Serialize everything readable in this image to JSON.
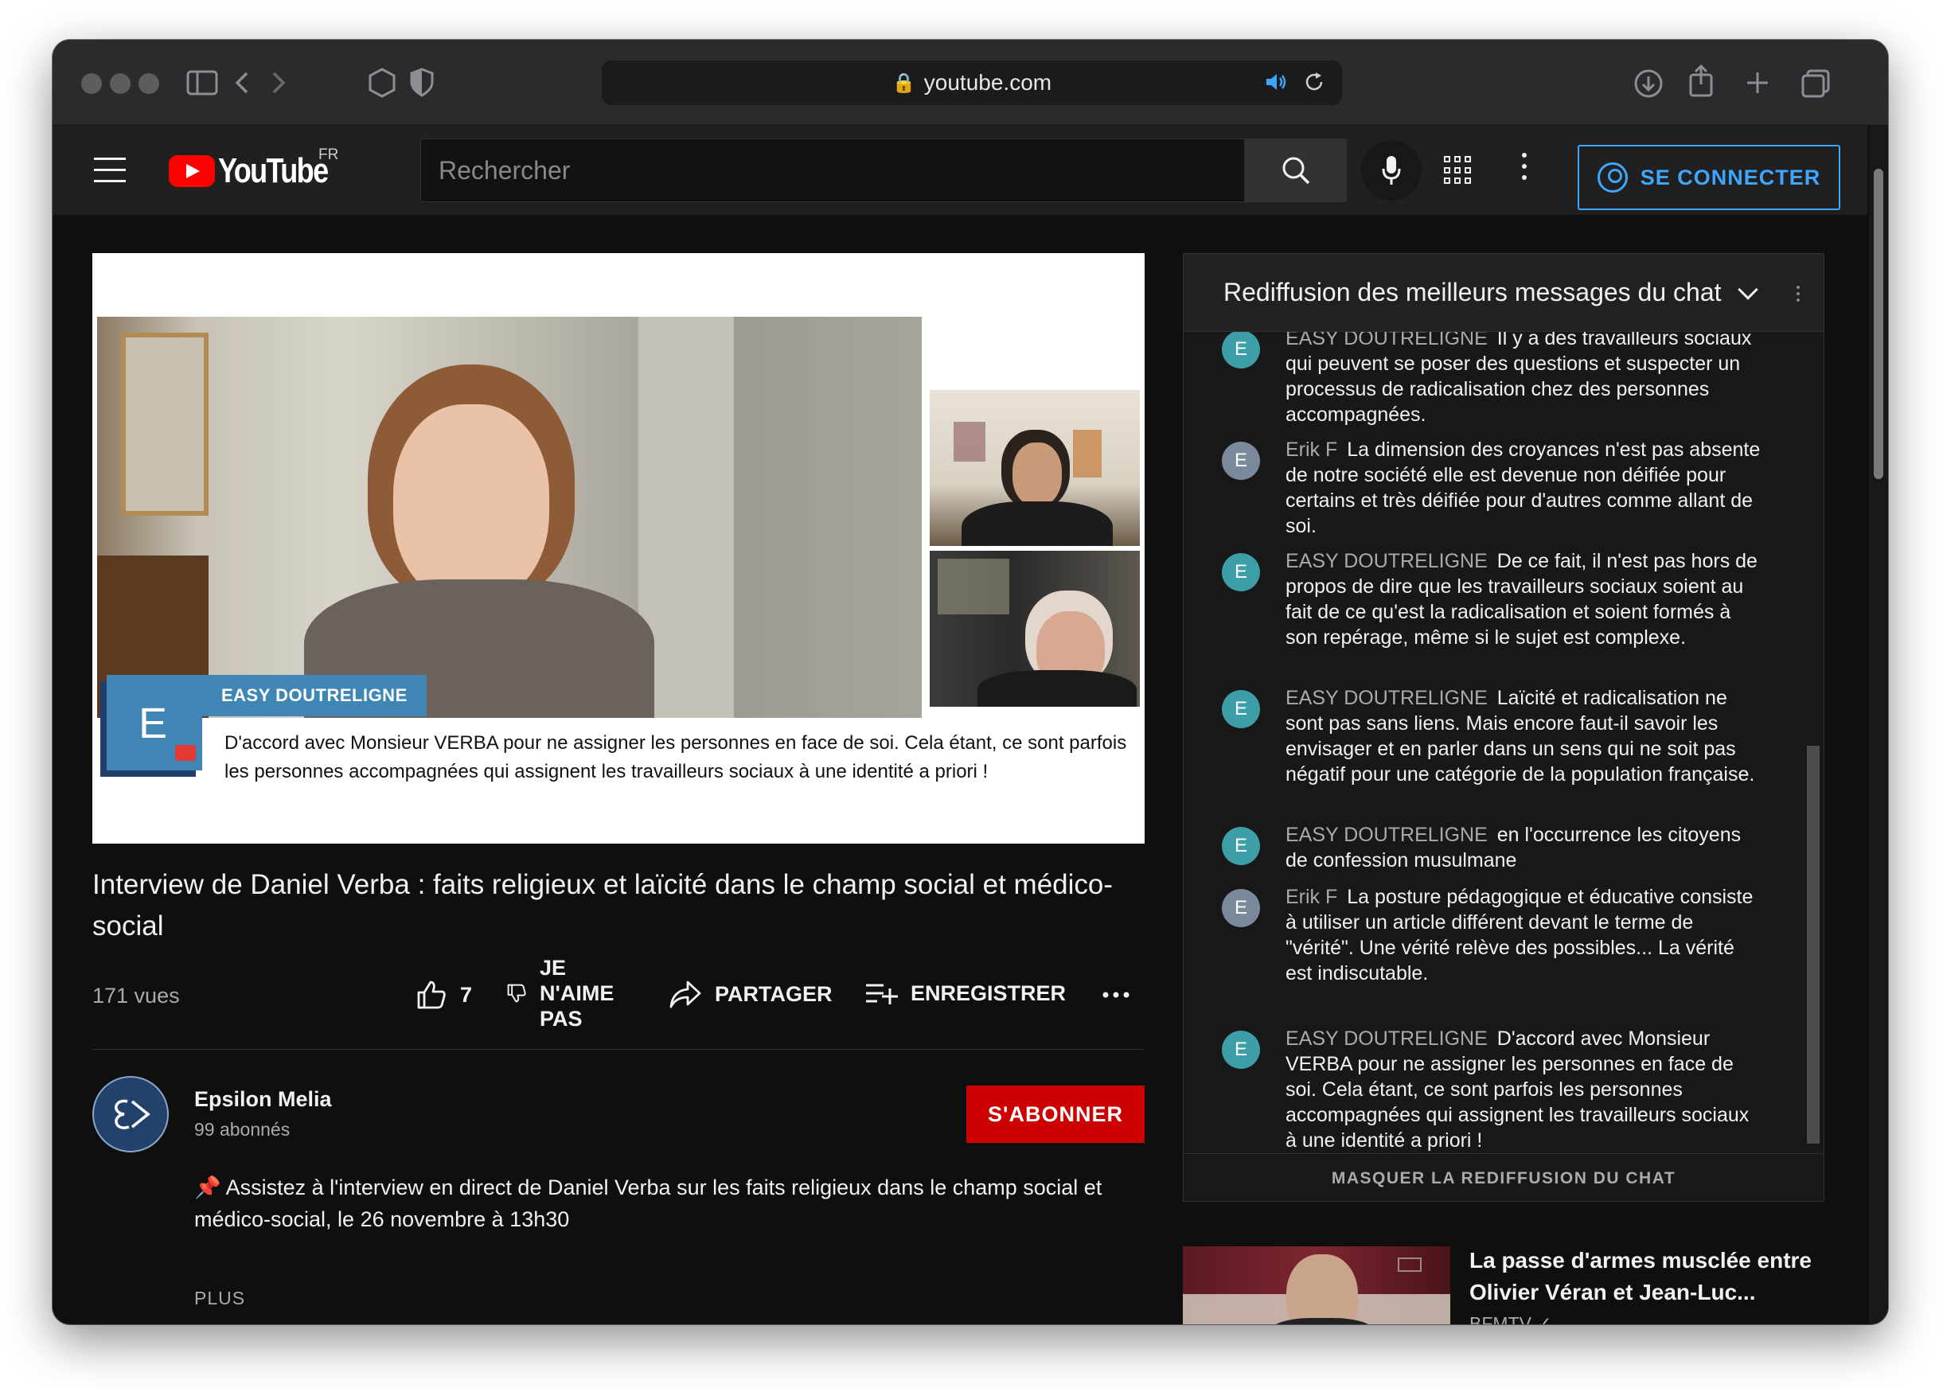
{
  "browser": {
    "url": "youtube.com",
    "lock_glyph": "🔒"
  },
  "masthead": {
    "logo_text": "YouTube",
    "region": "FR",
    "search_placeholder": "Rechercher",
    "signin_label": "SE CONNECTER"
  },
  "player": {
    "lower_third_logo_letter": "E",
    "lower_third_name": "EASY DOUTRELIGNE",
    "lower_third_text": "D'accord avec Monsieur VERBA pour ne assigner les personnes en face de soi. Cela étant, ce sont parfois les personnes accompagnées qui assignent les travailleurs sociaux à une identité a priori !"
  },
  "video": {
    "title": "Interview de Daniel Verba : faits religieux et laïcité dans le champ social et médico-social",
    "views": "171 vues",
    "likes": "7",
    "dislike_label": "JE N'AIME PAS",
    "share_label": "PARTAGER",
    "save_label": "ENREGISTRER"
  },
  "channel": {
    "name": "Epsilon Melia",
    "subscribers": "99 abonnés",
    "subscribe_label": "S'ABONNER",
    "description": "📌 Assistez à l'interview en direct de Daniel Verba sur les faits religieux dans le champ social et médico-social, le 26 novembre à 13h30",
    "more_label": "PLUS"
  },
  "chat": {
    "title": "Rediffusion des meilleurs messages du chat",
    "hide_label": "MASQUER LA REDIFFUSION DU CHAT",
    "colors": {
      "teal_avatar": "#3d9ea7",
      "grey_avatar": "#7b8a9a"
    },
    "messages": [
      {
        "initial": "E",
        "author": "EASY DOUTRELIGNE",
        "text": "Il y a des travailleurs sociaux qui peuvent se poser des questions et suspecter un processus de radicalisation chez des personnes accompagnées."
      },
      {
        "initial": "E",
        "author": "Erik F",
        "text": "La dimension des croyances n'est pas absente de notre société elle est devenue non déifiée pour certains et très déifiée pour d'autres comme allant de soi."
      },
      {
        "initial": "E",
        "author": "EASY DOUTRELIGNE",
        "text": "De ce fait, il n'est pas hors de propos de dire que les travailleurs sociaux soient au fait de ce qu'est la radicalisation et soient formés à son repérage, même si le sujet est complexe."
      },
      {
        "initial": "E",
        "author": "EASY DOUTRELIGNE",
        "text": "Laïcité et radicalisation ne sont pas sans liens. Mais encore faut-il savoir les envisager et en parler dans un sens qui ne soit pas négatif pour une catégorie de la population française."
      },
      {
        "initial": "E",
        "author": "EASY DOUTRELIGNE",
        "text": "en l'occurrence les citoyens de confession musulmane"
      },
      {
        "initial": "E",
        "author": "Erik F",
        "text": "La posture pédagogique et éducative consiste à utiliser un article différent devant le terme de \"vérité\". Une vérité relève des possibles... La vérité est indiscutable."
      },
      {
        "initial": "E",
        "author": "EASY DOUTRELIGNE",
        "text": "D'accord avec Monsieur VERBA pour ne assigner les personnes en face de soi. Cela étant, ce sont parfois les personnes accompagnées qui assignent les travailleurs sociaux à une identité a priori !"
      }
    ]
  },
  "recommended": {
    "title": "La passe d'armes musclée entre Olivier Véran et Jean-Luc...",
    "channel": "BFMTV ✓"
  }
}
